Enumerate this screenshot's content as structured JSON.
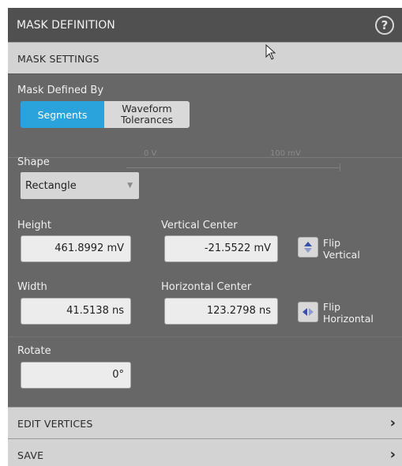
{
  "title": "MASK DEFINITION",
  "sections": {
    "mask_settings": "MASK SETTINGS",
    "edit_vertices": "EDIT VERTICES",
    "save": "SAVE"
  },
  "mask_defined_by": {
    "label": "Mask Defined By",
    "options": [
      "Segments",
      "Waveform Tolerances"
    ],
    "selected": "Segments"
  },
  "shape": {
    "label": "Shape",
    "value": "Rectangle"
  },
  "height": {
    "label": "Height",
    "value": "461.8992 mV"
  },
  "vertical_center": {
    "label": "Vertical Center",
    "value": "-21.5522 mV"
  },
  "width": {
    "label": "Width",
    "value": "41.5138 ns"
  },
  "horizontal_center": {
    "label": "Horizontal Center",
    "value": "123.2798 ns"
  },
  "rotate": {
    "label": "Rotate",
    "value": "0°"
  },
  "flip_vertical": {
    "line1": "Flip",
    "line2": "Vertical"
  },
  "flip_horizontal": {
    "line1": "Flip",
    "line2": "Horizontal"
  },
  "background_labels": [
    "0 V",
    "100 mV"
  ],
  "colors": {
    "accent": "#2aa3dc",
    "panel": "#676767",
    "header": "#505050"
  },
  "icons": [
    "help-icon",
    "dropdown-caret-icon",
    "flip-vertical-icon",
    "flip-horizontal-icon",
    "chevron-right-icon",
    "mouse-cursor-icon"
  ]
}
